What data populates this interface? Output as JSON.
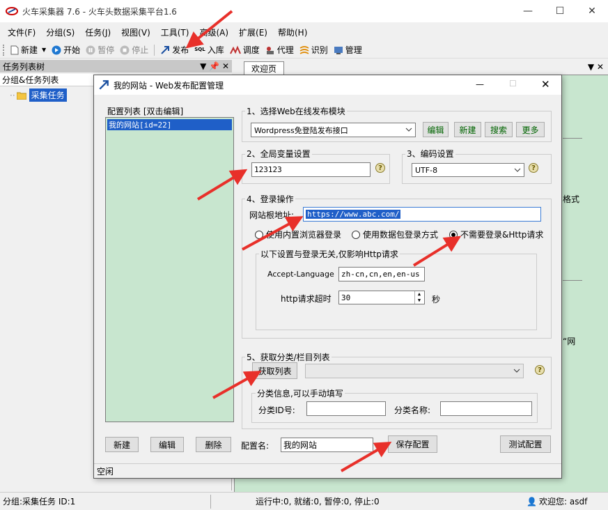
{
  "window": {
    "title": "火车采集器 7.6 - 火车头数据采集平台1.6",
    "min": "—",
    "max": "☐",
    "close": "✕"
  },
  "menu": [
    "文件(F)",
    "分组(S)",
    "任务(J)",
    "视图(V)",
    "工具(T)",
    "高级(A)",
    "扩展(E)",
    "帮助(H)"
  ],
  "toolbar": {
    "new": "新建",
    "start": "开始",
    "pause": "暂停",
    "stop": "停止",
    "publish": "发布",
    "import": "入库",
    "schedule": "调度",
    "proxy": "代理",
    "recognize": "识别",
    "manage": "管理",
    "sql_badge": "SQL"
  },
  "left_panel": {
    "title": "任务列表树",
    "pin": "▼ 📌 ✕",
    "subheader": "分组&任务列表",
    "tree_item": "采集任务"
  },
  "right_panel": {
    "tab": "欢迎页",
    "ctrl": "▼ ✕",
    "text1": "格式",
    "text2": "“网"
  },
  "dialog": {
    "title": "我的网站 - Web发布配置管理",
    "config_list_label": "配置列表 [双击编辑]",
    "config_item": "我的网站[id=22]",
    "g1": {
      "label": "1、选择Web在线发布模块",
      "module": "Wordpress免登陆发布接口",
      "edit": "编辑",
      "new": "新建",
      "search": "搜索",
      "more": "更多"
    },
    "g2": {
      "label": "2、全局变量设置",
      "value": "123123"
    },
    "g3": {
      "label": "3、编码设置",
      "value": "UTF-8"
    },
    "g4": {
      "label": "4、登录操作",
      "url_label": "网站根地址:",
      "url": "https://www.abc.com/",
      "r1": "使用内置浏览器登录",
      "r2": "使用数据包登录方式",
      "r3": "不需要登录&Http请求",
      "sub_label": "以下设置与登录无关,仅影响Http请求",
      "accept_label": "Accept-Language",
      "accept_value": "zh-cn,cn,en,en-us",
      "timeout_label": "http请求超时",
      "timeout_value": "30",
      "seconds": "秒"
    },
    "g5": {
      "label": "5、获取分类/栏目列表",
      "fetch": "获取列表",
      "sub_label": "分类信息,可以手动填写",
      "id_label": "分类ID号:",
      "name_label": "分类名称:"
    },
    "bottom": {
      "new": "新建",
      "edit": "编辑",
      "delete": "删除",
      "cfg_name_label": "配置名:",
      "cfg_name": "我的网站",
      "save": "保存配置",
      "test": "测试配置"
    },
    "status": "空闲"
  },
  "statusbar": {
    "left": "分组:采集任务  ID:1",
    "mid": "运行中:0, 就绪:0, 暂停:0, 停止:0",
    "right": "欢迎您: asdf"
  }
}
